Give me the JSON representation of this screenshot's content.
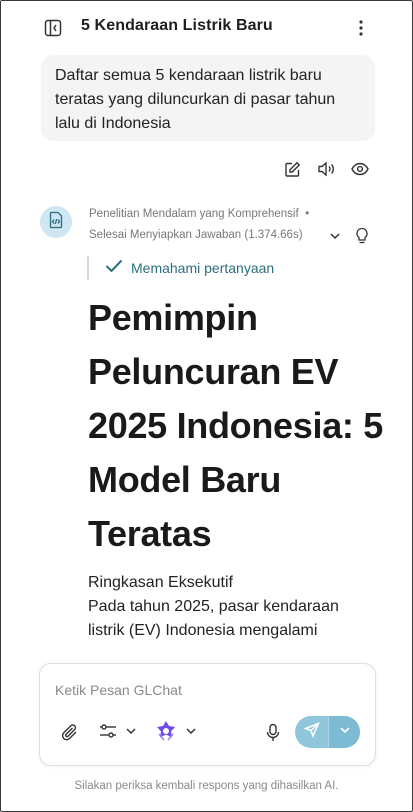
{
  "header": {
    "title": "5 Kendaraan Listrik Baru"
  },
  "user_message": "Daftar semua 5 kendaraan listrik baru teratas yang diluncurkan di pasar tahun lalu di Indonesia",
  "assistant": {
    "mode": "Penelitian Mendalam yang Komprehensif",
    "status": "Selesai Menyiapkan Jawaban",
    "duration": "(1.374.66s)",
    "step": "Memahami pertanyaan",
    "headline": "Pemimpin Peluncuran EV 2025 Indonesia: 5 Model Baru Teratas",
    "summary_heading": "Ringkasan Eksekutif",
    "summary_text": "Pada tahun 2025, pasar kendaraan listrik (EV) Indonesia mengalami"
  },
  "composer": {
    "placeholder": "Ketik Pesan GLChat"
  },
  "footer": "Silakan periksa kembali respons yang dihasilkan AI.",
  "colors": {
    "accent": "#2b6f7f",
    "send_button": "#8fc6dc",
    "avatar_bg": "#cfe6f3",
    "model_icon": "#6d4ce8"
  }
}
